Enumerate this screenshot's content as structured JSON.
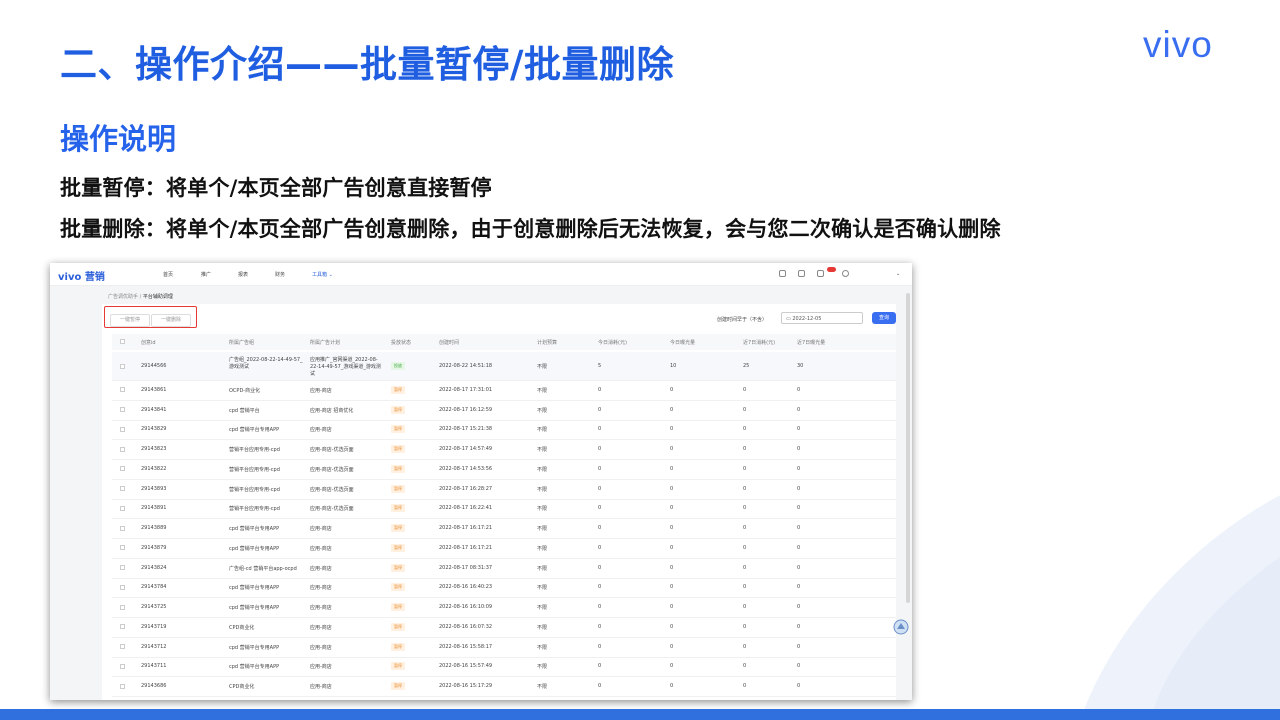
{
  "slide": {
    "title": "二、操作介绍——批量暂停/批量删除",
    "logo": "vivo",
    "section_heading": "操作说明",
    "desc_pause": "批量暂停：将单个/本页全部广告创意直接暂停",
    "desc_delete": "批量删除：将单个/本页全部广告创意删除，由于创意删除后无法恢复，会与您二次确认是否确认删除"
  },
  "screenshot": {
    "nav": {
      "logo": "vivo 营销",
      "items": [
        "首页",
        "推广",
        "报表",
        "财务",
        "工具箱"
      ],
      "active_item": "工具箱"
    },
    "breadcrumb": {
      "parent": "广告调优助手",
      "separator": "/",
      "current": "平台辅助调理"
    },
    "toolbar": {
      "pause_label": "一键暂停",
      "delete_label": "一键删除",
      "filter_label": "创建时间早于（不含）",
      "date_value": "2022-12-05",
      "query_label": "查询"
    },
    "columns": [
      "创意id",
      "所属广告组",
      "所属广告计划",
      "投放状态",
      "创建时间",
      "计划预算",
      "今日消耗(元)",
      "今日曝光量",
      "近7日消耗(元)",
      "近7日曝光量"
    ],
    "rows": [
      {
        "id": "29144566",
        "group": "广告组_2022-08-22-14-49-57_游戏测试",
        "plan": "应用推广_官网渠道_2022-08-22-14-49-57_游戏渠道_游戏测试",
        "status": "投放",
        "created": "2022-08-22 14:51:18",
        "budget": "不限",
        "today_cost": "5",
        "today_exp": "10",
        "week_cost": "25",
        "week_exp": "30"
      },
      {
        "id": "29143861",
        "group": "OCPD-商业化",
        "plan": "应用-商店",
        "status": "暂停",
        "created": "2022-08-17 17:31:01",
        "budget": "不限",
        "today_cost": "0",
        "today_exp": "0",
        "week_cost": "0",
        "week_exp": "0"
      },
      {
        "id": "29143841",
        "group": "cpd 营销平台",
        "plan": "应用-商店 招商优化",
        "status": "暂停",
        "created": "2022-08-17 16:12:59",
        "budget": "不限",
        "today_cost": "0",
        "today_exp": "0",
        "week_cost": "0",
        "week_exp": "0"
      },
      {
        "id": "29143829",
        "group": "cpd 营销平台专用APP",
        "plan": "应用-商店",
        "status": "暂停",
        "created": "2022-08-17 15:21:38",
        "budget": "不限",
        "today_cost": "0",
        "today_exp": "0",
        "week_cost": "0",
        "week_exp": "0"
      },
      {
        "id": "29143823",
        "group": "营销平台应用专用-cpd",
        "plan": "应用-商店-优选页面",
        "status": "暂停",
        "created": "2022-08-17 14:57:49",
        "budget": "不限",
        "today_cost": "0",
        "today_exp": "0",
        "week_cost": "0",
        "week_exp": "0"
      },
      {
        "id": "29143822",
        "group": "营销平台应用专用-cpd",
        "plan": "应用-商店-优选页面",
        "status": "暂停",
        "created": "2022-08-17 14:53:56",
        "budget": "不限",
        "today_cost": "0",
        "today_exp": "0",
        "week_cost": "0",
        "week_exp": "0"
      },
      {
        "id": "29143893",
        "group": "营销平台应用专用-cpd",
        "plan": "应用-商店-优选页面",
        "status": "暂停",
        "created": "2022-08-17 16:28:27",
        "budget": "不限",
        "today_cost": "0",
        "today_exp": "0",
        "week_cost": "0",
        "week_exp": "0"
      },
      {
        "id": "29143891",
        "group": "营销平台应用专用-cpd",
        "plan": "应用-商店-优选页面",
        "status": "暂停",
        "created": "2022-08-17 16:22:41",
        "budget": "不限",
        "today_cost": "0",
        "today_exp": "0",
        "week_cost": "0",
        "week_exp": "0"
      },
      {
        "id": "29143889",
        "group": "cpd 营销平台专用APP",
        "plan": "应用-商店",
        "status": "暂停",
        "created": "2022-08-17 16:17:21",
        "budget": "不限",
        "today_cost": "0",
        "today_exp": "0",
        "week_cost": "0",
        "week_exp": "0"
      },
      {
        "id": "29143879",
        "group": "cpd 营销平台专用APP",
        "plan": "应用-商店",
        "status": "暂停",
        "created": "2022-08-17 16:17:21",
        "budget": "不限",
        "today_cost": "0",
        "today_exp": "0",
        "week_cost": "0",
        "week_exp": "0"
      },
      {
        "id": "29143824",
        "group": "广告组-cd 营销平台app-ocpd",
        "plan": "应用-商店",
        "status": "暂停",
        "created": "2022-08-17 08:31:37",
        "budget": "不限",
        "today_cost": "0",
        "today_exp": "0",
        "week_cost": "0",
        "week_exp": "0"
      },
      {
        "id": "29143784",
        "group": "cpd 营销平台专用APP",
        "plan": "应用-商店",
        "status": "暂停",
        "created": "2022-08-16 16:40:23",
        "budget": "不限",
        "today_cost": "0",
        "today_exp": "0",
        "week_cost": "0",
        "week_exp": "0"
      },
      {
        "id": "29143725",
        "group": "cpd 营销平台专用APP",
        "plan": "应用-商店",
        "status": "暂停",
        "created": "2022-08-16 16:10:09",
        "budget": "不限",
        "today_cost": "0",
        "today_exp": "0",
        "week_cost": "0",
        "week_exp": "0"
      },
      {
        "id": "29143719",
        "group": "CPD商业化",
        "plan": "应用-商店",
        "status": "暂停",
        "created": "2022-08-16 16:07:32",
        "budget": "不限",
        "today_cost": "0",
        "today_exp": "0",
        "week_cost": "0",
        "week_exp": "0"
      },
      {
        "id": "29143712",
        "group": "cpd 营销平台专用APP",
        "plan": "应用-商店",
        "status": "暂停",
        "created": "2022-08-16 15:58:17",
        "budget": "不限",
        "today_cost": "0",
        "today_exp": "0",
        "week_cost": "0",
        "week_exp": "0"
      },
      {
        "id": "29143711",
        "group": "cpd 营销平台专用APP",
        "plan": "应用-商店",
        "status": "暂停",
        "created": "2022-08-16 15:57:49",
        "budget": "不限",
        "today_cost": "0",
        "today_exp": "0",
        "week_cost": "0",
        "week_exp": "0"
      },
      {
        "id": "29143686",
        "group": "CPD商业化",
        "plan": "应用-商店",
        "status": "暂停",
        "created": "2022-08-16 15:17:29",
        "budget": "不限",
        "today_cost": "0",
        "today_exp": "0",
        "week_cost": "0",
        "week_exp": "0"
      }
    ]
  },
  "colors": {
    "title_blue": "#1f5ee0",
    "accent_blue": "#3a6ef0",
    "highlight_red": "#e53935",
    "paused_orange": "#e88a2a",
    "active_green": "#3aa63a"
  }
}
